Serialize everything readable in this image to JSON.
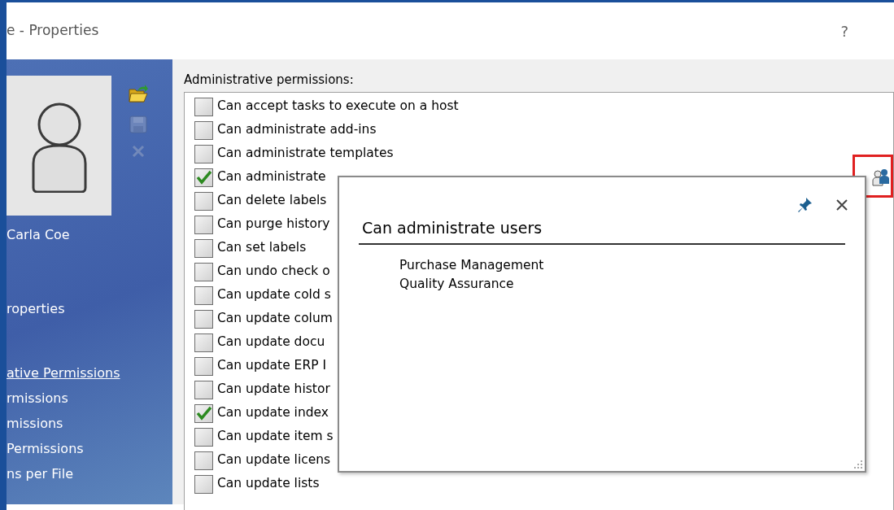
{
  "window": {
    "title": "e - Properties",
    "help": "?"
  },
  "sidebar": {
    "actions": [
      {
        "kind": "open",
        "disabled": false
      },
      {
        "kind": "save",
        "disabled": true
      },
      {
        "kind": "delete",
        "disabled": true
      }
    ],
    "user_name": "Carla Coe",
    "link_groups": [
      {
        "links": [
          {
            "label": "roperties",
            "selected": false
          }
        ]
      },
      {
        "links": [
          {
            "label": "ative Permissions",
            "selected": true
          },
          {
            "label": "rmissions",
            "selected": false
          },
          {
            "label": "missions",
            "selected": false
          },
          {
            "label": "Permissions",
            "selected": false
          },
          {
            "label": "ns per File",
            "selected": false
          }
        ]
      }
    ]
  },
  "permissions": {
    "label": "Administrative permissions:",
    "items": [
      {
        "label": "Can accept tasks to execute on a host",
        "checked": false
      },
      {
        "label": "Can administrate add-ins",
        "checked": false
      },
      {
        "label": "Can administrate templates",
        "checked": false
      },
      {
        "label": "Can administrate",
        "checked": true
      },
      {
        "label": "Can delete labels",
        "checked": false
      },
      {
        "label": "Can purge history",
        "checked": false
      },
      {
        "label": "Can set labels",
        "checked": false
      },
      {
        "label": "Can undo check o",
        "checked": false
      },
      {
        "label": "Can update cold s",
        "checked": false
      },
      {
        "label": "Can update colum",
        "checked": false
      },
      {
        "label": "Can update docu",
        "checked": false
      },
      {
        "label": "Can update ERP I",
        "checked": false
      },
      {
        "label": "Can update histor",
        "checked": false
      },
      {
        "label": "Can update index",
        "checked": true
      },
      {
        "label": "Can update item s",
        "checked": false
      },
      {
        "label": "Can update licens",
        "checked": false
      },
      {
        "label": "Can update lists",
        "checked": false
      }
    ]
  },
  "users_button": {
    "highlighted": true
  },
  "popup": {
    "title": "Can administrate users",
    "items": [
      "Purchase Management",
      "Quality Assurance"
    ]
  }
}
